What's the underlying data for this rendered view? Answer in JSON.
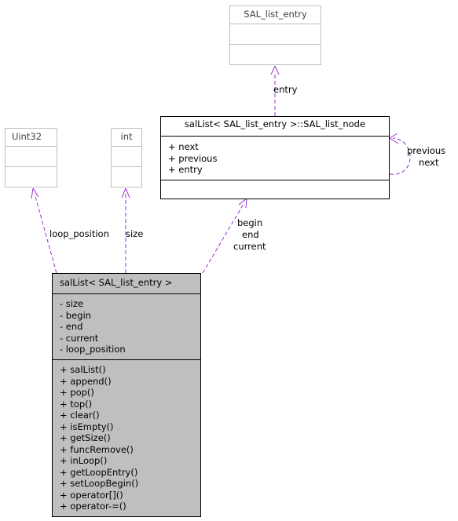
{
  "nodes": {
    "sal_list_entry": {
      "title": "SAL_list_entry"
    },
    "uint32": {
      "title": "Uint32"
    },
    "int": {
      "title": "int"
    },
    "list_node": {
      "title": "salList< SAL_list_entry >::SAL_list_node",
      "attributes": [
        "+ next",
        "+ previous",
        "+ entry"
      ],
      "methods": []
    },
    "sal_list": {
      "title": "salList< SAL_list_entry >",
      "attributes": [
        "- size",
        "- begin",
        "- end",
        "- current",
        "- loop_position"
      ],
      "methods": [
        "+ salList()",
        "+ append()",
        "+ pop()",
        "+ top()",
        "+ clear()",
        "+ isEmpty()",
        "+ getSize()",
        "+ funcRemove()",
        "+ inLoop()",
        "+ getLoopEntry()",
        "+ setLoopBegin()",
        "+ operator[]()",
        "+ operator-=()"
      ]
    }
  },
  "edges": {
    "entry": {
      "label": "entry"
    },
    "self": {
      "label_line1": "previous",
      "label_line2": "next"
    },
    "loop_position": {
      "label": "loop_position"
    },
    "size": {
      "label": "size"
    },
    "begin_end_current": {
      "label_line1": "begin",
      "label_line2": "end",
      "label_line3": "current"
    }
  },
  "colors": {
    "edge": "#9a32cd",
    "ghost_border": "#bfbfbf",
    "main_fill": "#bfbfbf"
  }
}
